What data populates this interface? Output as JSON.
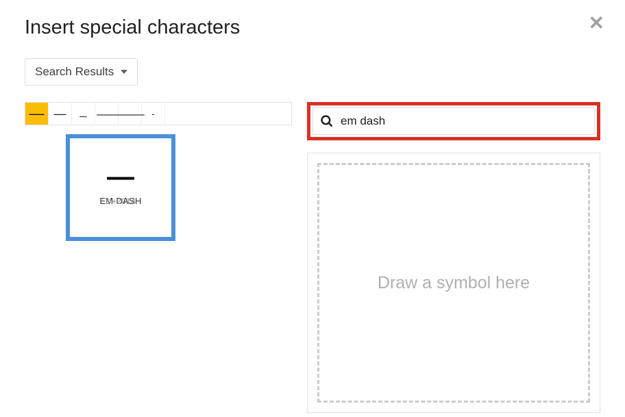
{
  "dialog": {
    "title": "Insert special characters",
    "category_label": "Search Results"
  },
  "results": {
    "chars": [
      "—",
      "―",
      "﹘",
      "⸺",
      "⸻",
      "-"
    ],
    "selected_index": 0
  },
  "preview": {
    "glyph": "—",
    "name": "EM DASH",
    "codepoint": "U+2014"
  },
  "search": {
    "value": "em dash"
  },
  "draw": {
    "placeholder": "Draw a symbol here"
  }
}
